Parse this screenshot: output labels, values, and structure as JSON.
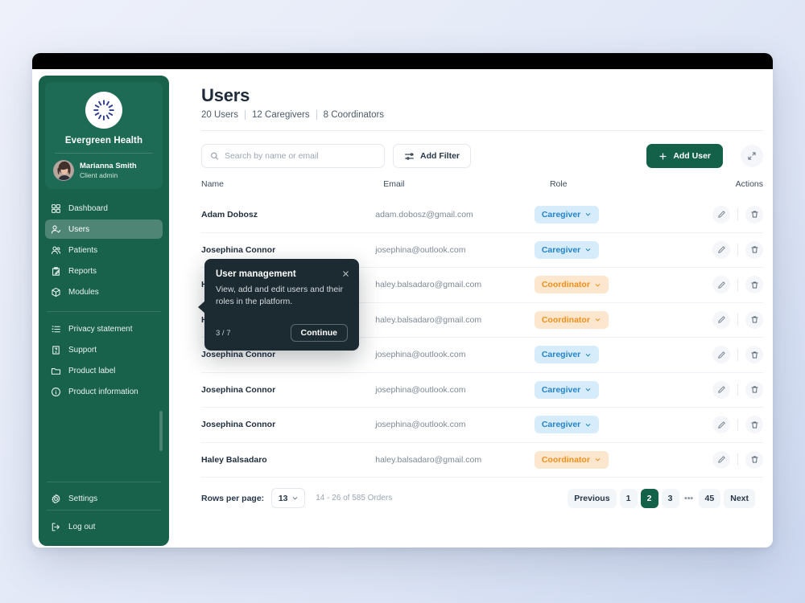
{
  "sidebar": {
    "brand": {
      "name": "Evergreen Health",
      "logo_icon": "sun-burst-logo-icon"
    },
    "user": {
      "name": "Marianna Smith",
      "role": "Client admin",
      "avatar_icon": "user-avatar"
    },
    "primary_items": [
      {
        "label": "Dashboard",
        "icon": "grid-icon",
        "active": false
      },
      {
        "label": "Users",
        "icon": "user-check-icon",
        "active": true
      },
      {
        "label": "Patients",
        "icon": "users-icon",
        "active": false
      },
      {
        "label": "Reports",
        "icon": "clipboard-pen-icon",
        "active": false
      },
      {
        "label": "Modules",
        "icon": "cube-icon",
        "active": false
      }
    ],
    "secondary_items": [
      {
        "label": "Privacy statement",
        "icon": "list-icon"
      },
      {
        "label": "Support",
        "icon": "doc-question-icon"
      },
      {
        "label": "Product label",
        "icon": "folder-icon"
      },
      {
        "label": "Product information",
        "icon": "info-circle-icon"
      }
    ],
    "settings": {
      "label": "Settings",
      "icon": "gear-icon"
    },
    "logout": {
      "label": "Log out",
      "icon": "logout-icon"
    }
  },
  "header": {
    "title": "Users",
    "stats": [
      "20 Users",
      "12 Caregivers",
      "8 Coordinators"
    ]
  },
  "toolbar": {
    "search_placeholder": "Search by name or email",
    "search_value": "",
    "search_icon": "search-icon",
    "filter_label": "Add Filter",
    "filter_icon": "sliders-icon",
    "add_user_label": "Add User",
    "add_user_icon": "plus-icon",
    "expand_icon": "expand-arrows-icon"
  },
  "table": {
    "columns": [
      "Name",
      "Email",
      "Role",
      "Actions"
    ],
    "rows": [
      {
        "name": "Adam Dobosz",
        "email": "adam.dobosz@gmail.com",
        "role": "Caregiver",
        "role_type": "caregiver"
      },
      {
        "name": "Josephina Connor",
        "email": "josephina@outlook.com",
        "role": "Caregiver",
        "role_type": "caregiver"
      },
      {
        "name": "Haley Balsadaro",
        "email": "haley.balsadaro@gmail.com",
        "role": "Coordinator",
        "role_type": "coordinator"
      },
      {
        "name": "Haley Balsadaro",
        "email": "haley.balsadaro@gmail.com",
        "role": "Coordinator",
        "role_type": "coordinator"
      },
      {
        "name": "Josephina Connor",
        "email": "josephina@outlook.com",
        "role": "Caregiver",
        "role_type": "caregiver"
      },
      {
        "name": "Josephina Connor",
        "email": "josephina@outlook.com",
        "role": "Caregiver",
        "role_type": "caregiver"
      },
      {
        "name": "Josephina Connor",
        "email": "josephina@outlook.com",
        "role": "Caregiver",
        "role_type": "caregiver"
      },
      {
        "name": "Haley Balsadaro",
        "email": "haley.balsadaro@gmail.com",
        "role": "Coordinator",
        "role_type": "coordinator"
      }
    ],
    "row_actions": {
      "edit_icon": "pencil-icon",
      "delete_icon": "trash-icon"
    }
  },
  "footer": {
    "rows_per_page_label": "Rows per page:",
    "rows_per_page_value": "13",
    "range_label": "14 - 26 of 585 Orders",
    "pagination": {
      "previous_label": "Previous",
      "next_label": "Next",
      "pages": [
        "1",
        "2",
        "3",
        "…",
        "45"
      ],
      "active_page": "2"
    }
  },
  "coachmark": {
    "title": "User management",
    "body": "View, add and edit users and their roles in the platform.",
    "step": "3 / 7",
    "continue_label": "Continue",
    "close_icon": "close-icon"
  },
  "colors": {
    "brand_green": "#14614a",
    "sidebar_green": "#18614b",
    "caregiver_bg": "#d7ecfa",
    "caregiver_fg": "#2384c9",
    "coordinator_bg": "#fde6ce",
    "coordinator_fg": "#f09019",
    "coach_bg": "#1c2b31"
  }
}
